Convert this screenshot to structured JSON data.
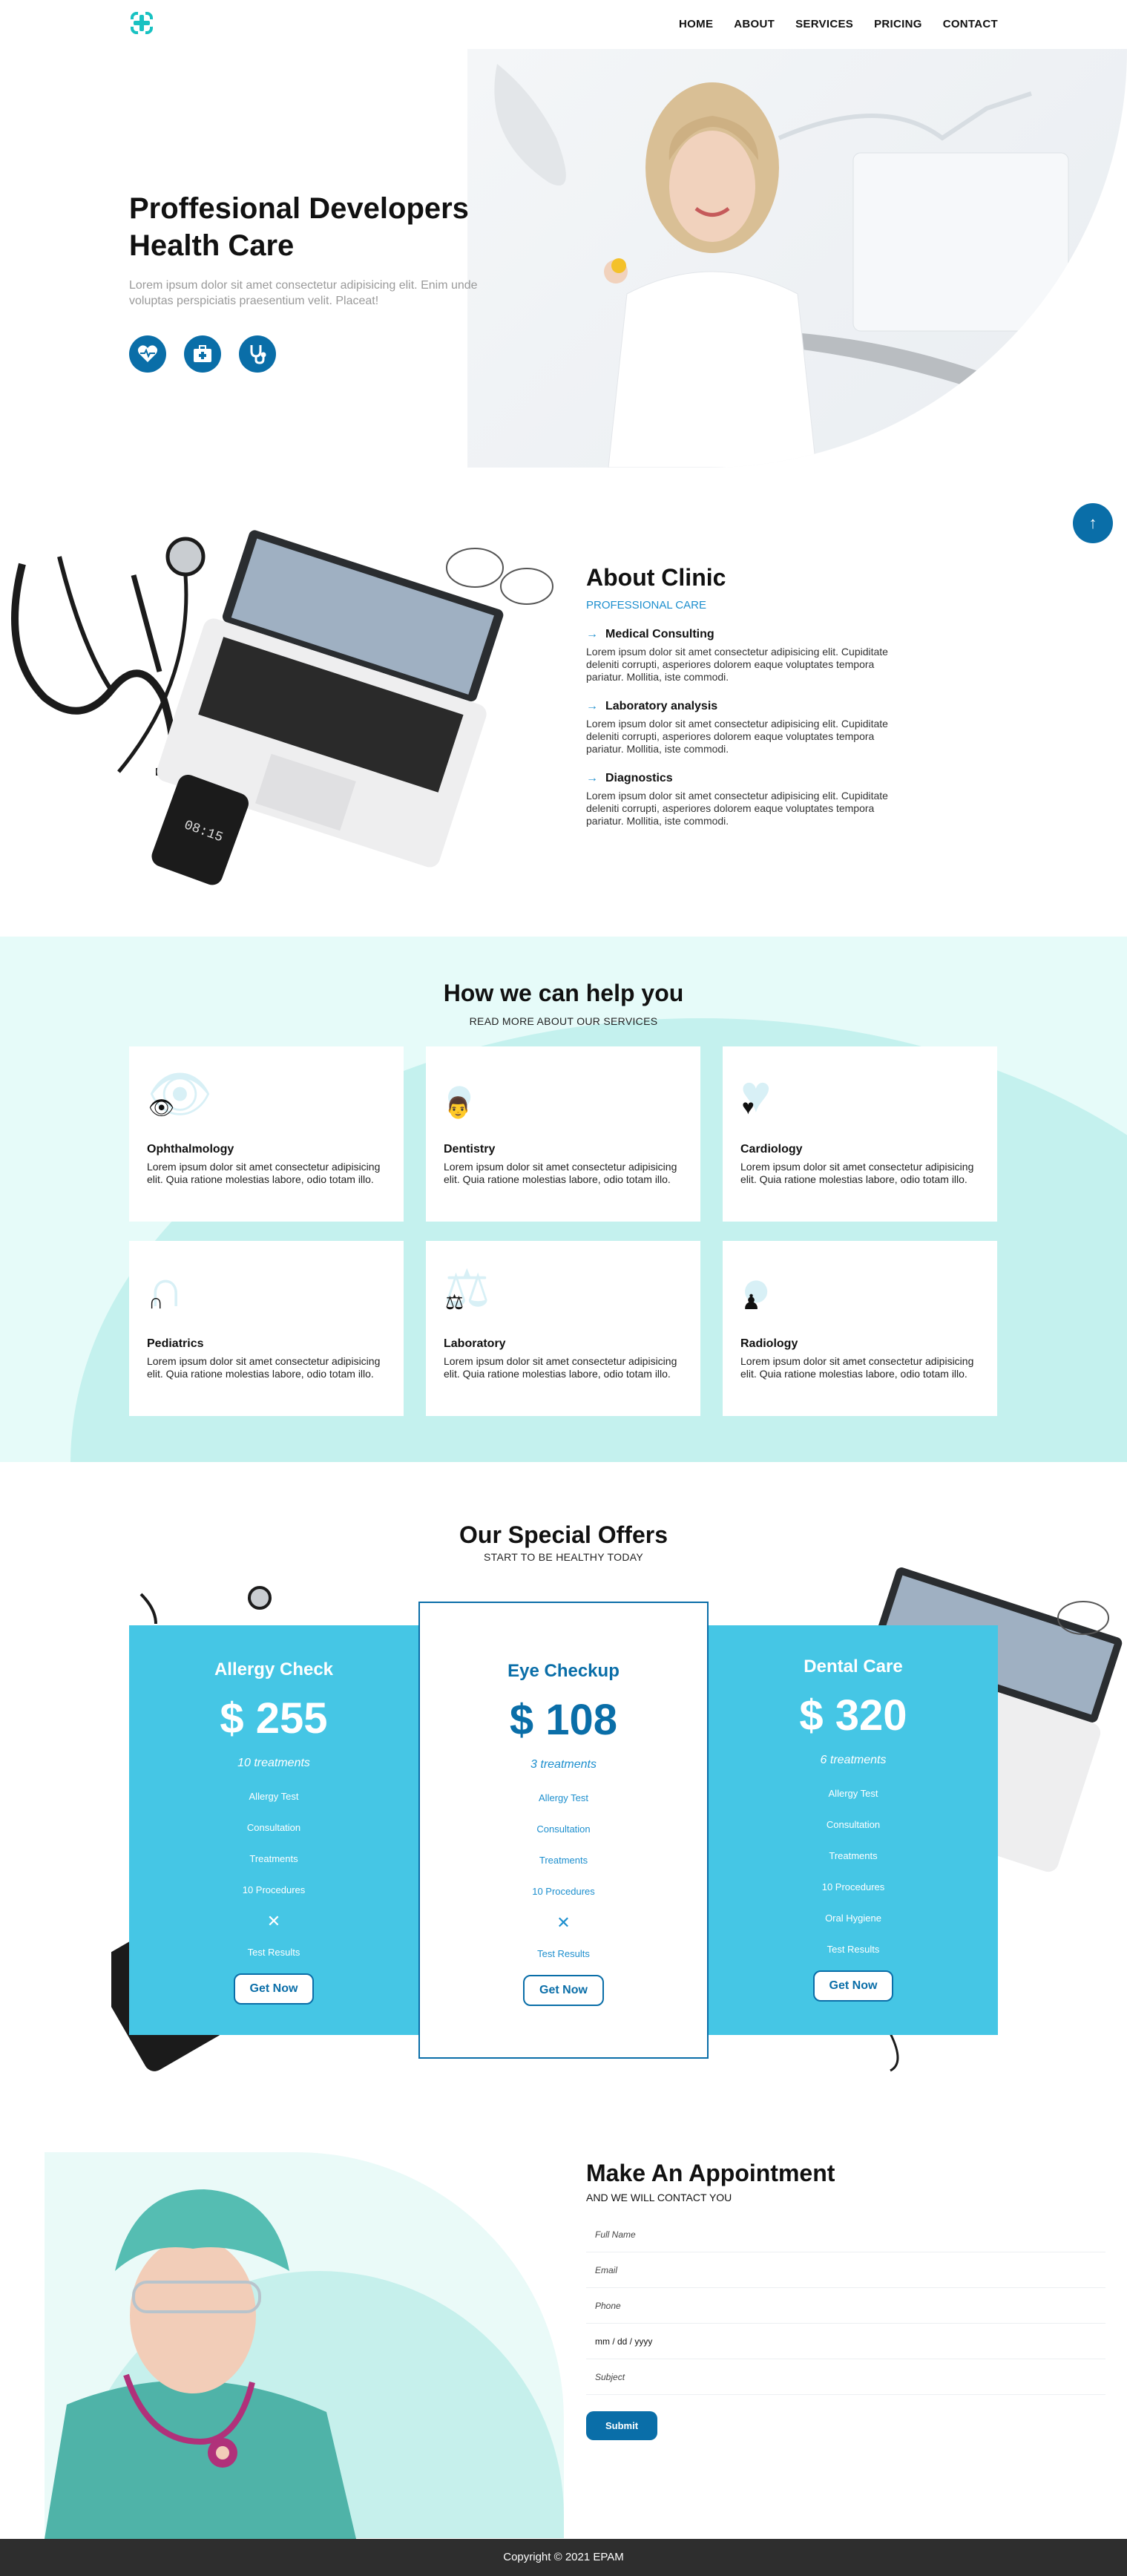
{
  "nav": {
    "items": [
      "HOME",
      "ABOUT",
      "SERVICES",
      "PRICING",
      "CONTACT"
    ]
  },
  "hero": {
    "title": "Proffesional Developers Health Care",
    "text": "Lorem ipsum dolor sit amet consectetur adipisicing elit. Enim unde voluptas perspiciatis praesentium velit. Placeat!",
    "icons": [
      "heart-pulse-icon",
      "medkit-icon",
      "stethoscope-icon"
    ]
  },
  "about": {
    "title": "About Clinic",
    "subtitle": "PROFESSIONAL CARE",
    "features": [
      {
        "title": "Medical Consulting",
        "text": "Lorem ipsum dolor sit amet consectetur adipisicing elit. Cupiditate deleniti corrupti, asperiores dolorem eaque voluptates tempora pariatur. Mollitia, iste commodi."
      },
      {
        "title": "Laboratory analysis",
        "text": "Lorem ipsum dolor sit amet consectetur adipisicing elit. Cupiditate deleniti corrupti, asperiores dolorem eaque voluptates tempora pariatur. Mollitia, iste commodi."
      },
      {
        "title": "Diagnostics",
        "text": "Lorem ipsum dolor sit amet consectetur adipisicing elit. Cupiditate deleniti corrupti, asperiores dolorem eaque voluptates tempora pariatur. Mollitia, iste commodi."
      }
    ]
  },
  "services": {
    "title": "How we can help you",
    "subtitle": "READ MORE ABOUT OUR SERVICES",
    "cards": [
      {
        "title": "Ophthalmology",
        "icon": "eye-icon",
        "text": "Lorem ipsum dolor sit amet consectetur adipisicing elit. Quia ratione molestias labore, odio totam illo."
      },
      {
        "title": "Dentistry",
        "icon": "doctor-icon",
        "text": "Lorem ipsum dolor sit amet consectetur adipisicing elit. Quia ratione molestias labore, odio totam illo."
      },
      {
        "title": "Cardiology",
        "icon": "heartbeat-icon",
        "text": "Lorem ipsum dolor sit amet consectetur adipisicing elit. Quia ratione molestias labore, odio totam illo."
      },
      {
        "title": "Pediatrics",
        "icon": "stethoscope-icon",
        "text": "Lorem ipsum dolor sit amet consectetur adipisicing elit. Quia ratione molestias labore, odio totam illo."
      },
      {
        "title": "Laboratory",
        "icon": "balance-scale-icon",
        "text": "Lorem ipsum dolor sit amet consectetur adipisicing elit. Quia ratione molestias labore, odio totam illo."
      },
      {
        "title": "Radiology",
        "icon": "radiology-icon",
        "text": "Lorem ipsum dolor sit amet consectetur adipisicing elit. Quia ratione molestias labore, odio totam illo."
      }
    ]
  },
  "offers": {
    "title": "Our Special Offers",
    "subtitle": "START TO BE HEALTHY TODAY",
    "plans": [
      {
        "name": "Allergy Check",
        "price": "$ 255",
        "treatments": "10 treatments",
        "items": [
          "Allergy Test",
          "Consultation",
          "Treatments",
          "10 Procedures",
          "✕",
          "Test Results"
        ],
        "button": "Get Now"
      },
      {
        "name": "Eye Checkup",
        "price": "$ 108",
        "treatments": "3 treatments",
        "items": [
          "Allergy Test",
          "Consultation",
          "Treatments",
          "10 Procedures",
          "✕",
          "Test Results"
        ],
        "button": "Get Now"
      },
      {
        "name": "Dental Care",
        "price": "$ 320",
        "treatments": "6 treatments",
        "items": [
          "Allergy Test",
          "Consultation",
          "Treatments",
          "10 Procedures",
          "Oral Hygiene",
          "Test Results"
        ],
        "button": "Get Now"
      }
    ]
  },
  "appointment": {
    "title": "Make An Appointment",
    "subtitle": "AND WE WILL CONTACT YOU",
    "fields": {
      "name": "Full Name",
      "email": "Email",
      "phone": "Phone",
      "date": "mm / dd / yyyy",
      "subject": "Subject"
    },
    "submit": "Submit"
  },
  "footer": {
    "copyright": "Copyright © 2021 EPAM"
  },
  "colors": {
    "primary": "#0a6ea8",
    "accent": "#45c6e5",
    "mint": "#c4f1ee",
    "footer": "#2e2e2e"
  }
}
